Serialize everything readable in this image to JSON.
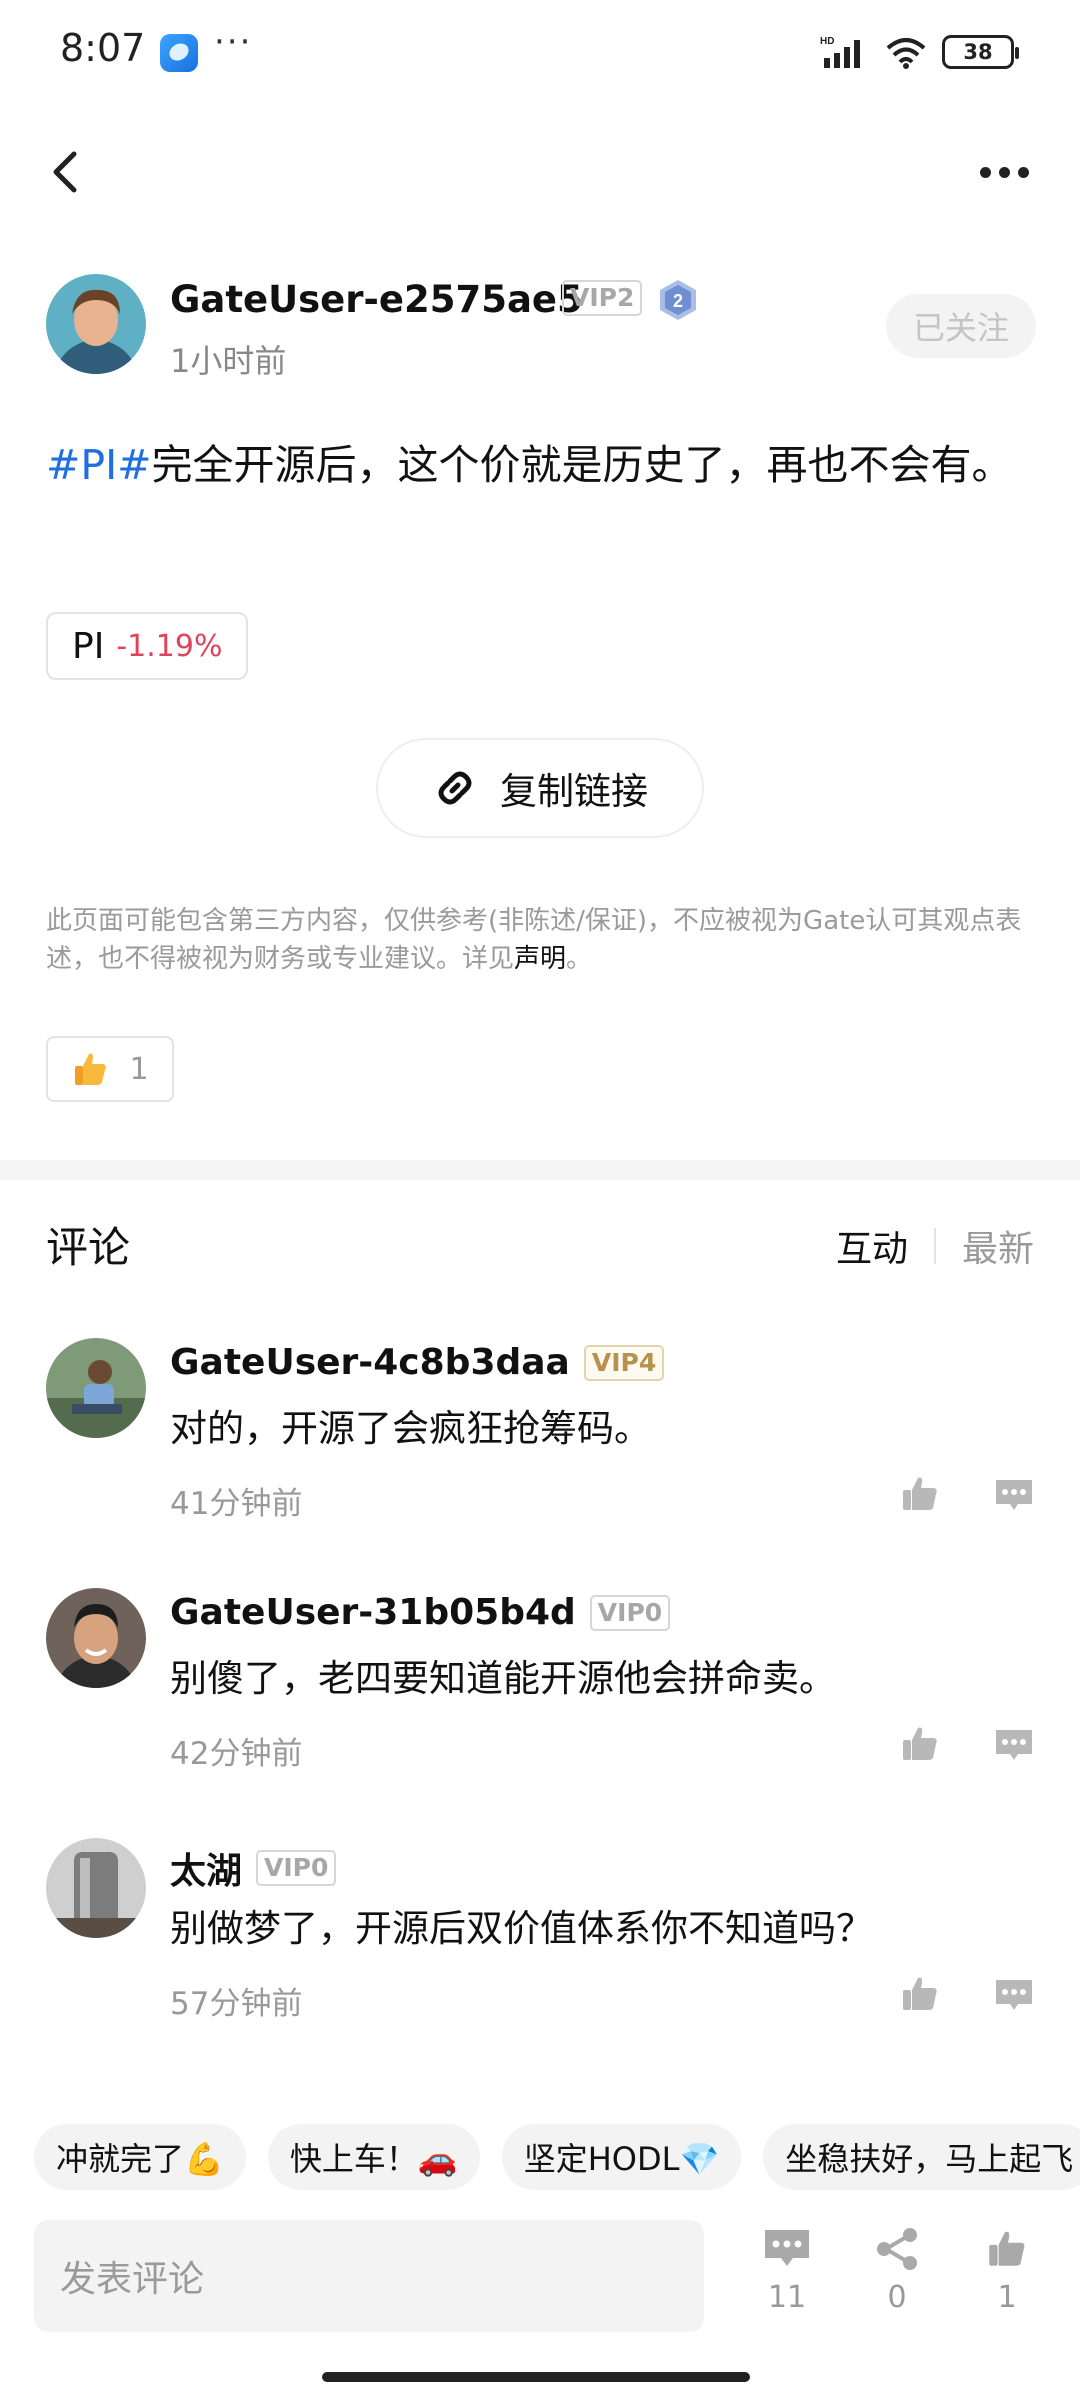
{
  "status_bar": {
    "time": "8:07",
    "more": "···",
    "network": "HD",
    "battery": "38",
    "icons": [
      "app-icon",
      "signal-icon",
      "wifi-icon",
      "battery-icon"
    ]
  },
  "nav": {
    "back_icon": "chevron-left-icon",
    "more_icon": "more-horizontal-icon"
  },
  "author": {
    "name": "GateUser-e2575ae5",
    "vip": "VIP2",
    "rank": "2",
    "time": "1小时前",
    "follow_label": "已关注"
  },
  "post": {
    "hashtag": "#PI#",
    "text": "完全开源后，这个价就是历史了，再也不会有。",
    "coin_symbol": "PI",
    "coin_change": "-1.19%",
    "copy_link_label": "复制链接",
    "disclaimer": "此页面可能包含第三方内容，仅供参考(非陈述/保证)，不应被视为Gate认可其观点表述，也不得被视为财务或专业建议。详见",
    "disclaimer_link": "声明",
    "disclaimer_end": "。",
    "like_count": "1"
  },
  "comments_section": {
    "title": "评论",
    "sort_active": "互动",
    "sort_inactive": "最新",
    "items": [
      {
        "name": "GateUser-4c8b3daa",
        "vip": "VIP4",
        "text": "对的，开源了会疯狂抢筹码。",
        "time": "41分钟前"
      },
      {
        "name": "GateUser-31b05b4d",
        "vip": "VIP0",
        "text": "别傻了，老四要知道能开源他会拼命卖。",
        "time": "42分钟前"
      },
      {
        "name": "太湖",
        "vip": "VIP0",
        "text": "别做梦了，开源后双价值体系你不知道吗？",
        "time": "57分钟前"
      }
    ]
  },
  "quick_replies": [
    "冲就完了💪",
    "快上车！🚗",
    "坚定HODL💎",
    "坐稳扶好，马上起飞"
  ],
  "bottom_bar": {
    "input_placeholder": "发表评论",
    "comment_count": "11",
    "share_count": "0",
    "like_count": "1"
  },
  "colors": {
    "hashtag": "#1f6fe0",
    "negative": "#e0435d",
    "vip_gold": "#b8904f"
  }
}
